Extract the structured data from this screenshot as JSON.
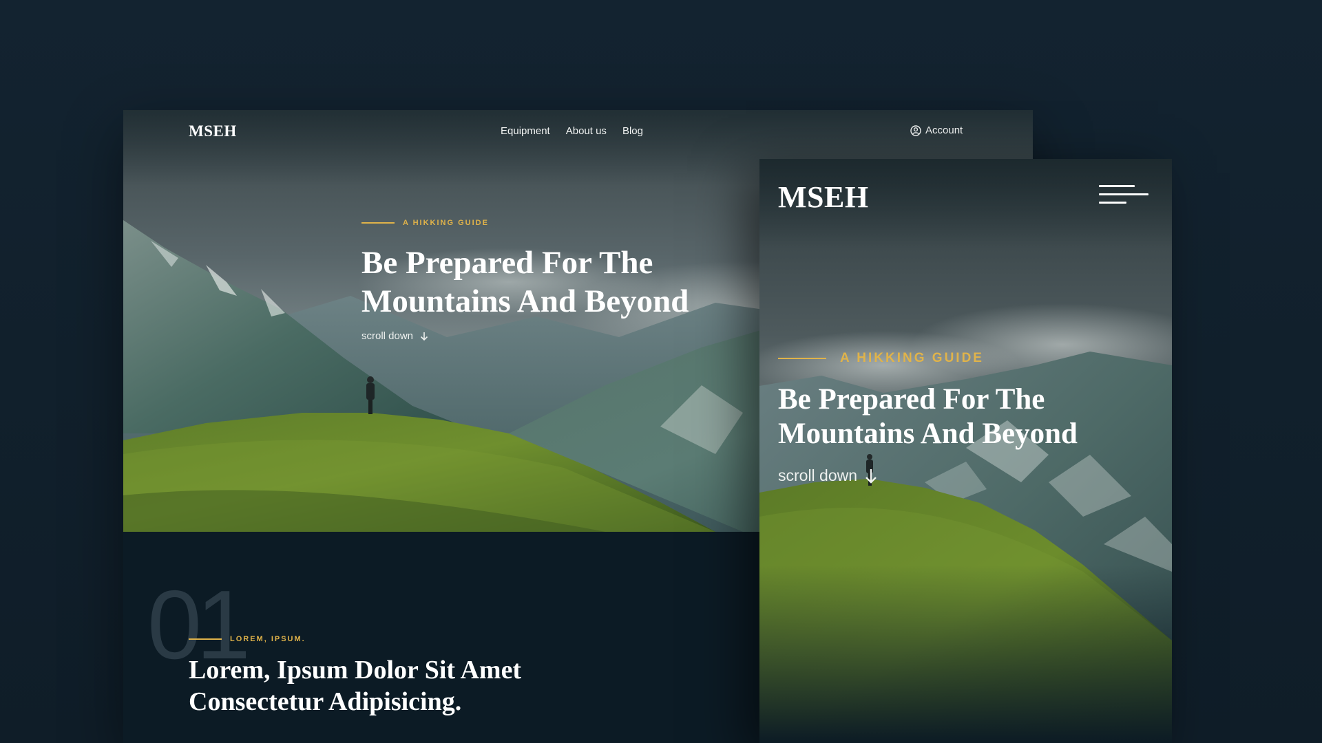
{
  "desktop": {
    "logo": "MSEH",
    "nav": {
      "items": [
        {
          "label": "Equipment"
        },
        {
          "label": "About us"
        },
        {
          "label": "Blog"
        }
      ],
      "account_label": "Account"
    },
    "hero": {
      "eyebrow": "A HIKKING GUIDE",
      "headline_line1": "Be Prepared For The",
      "headline_line2": "Mountains And Beyond",
      "scroll_label": "scroll down"
    },
    "section": {
      "number": "01",
      "eyebrow": "LOREM, IPSUM.",
      "title_line1": "Lorem, Ipsum Dolor Sit Amet",
      "title_line2": "Consectetur Adipisicing."
    }
  },
  "mobile": {
    "logo": "MSEH",
    "hero": {
      "eyebrow": "A HIKKING GUIDE",
      "headline_line1": "Be Prepared For The",
      "headline_line2": "Mountains And Beyond",
      "scroll_label": "scroll down"
    }
  },
  "icons": {
    "account": "user-circle-icon",
    "scroll": "arrow-down-icon",
    "menu": "hamburger-menu-icon"
  },
  "colors": {
    "page_background": "#11202b",
    "accent": "#e0b34a",
    "text": "#ffffff",
    "section_background": "#0c1b25"
  }
}
